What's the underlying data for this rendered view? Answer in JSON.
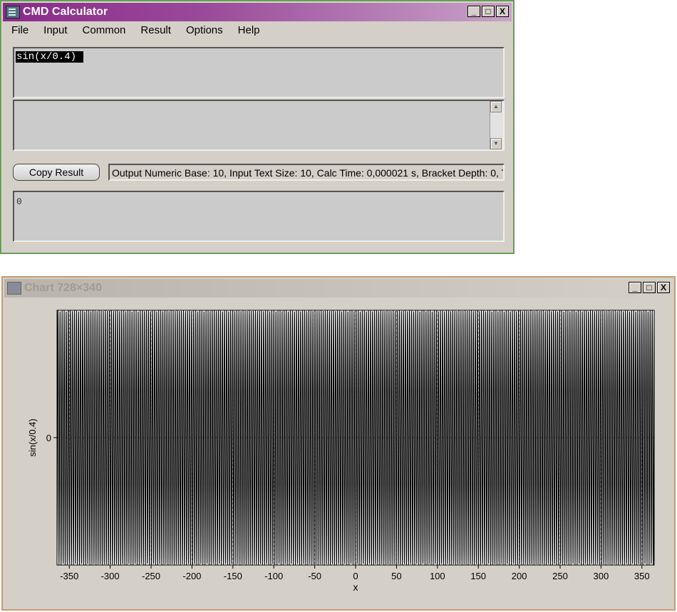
{
  "calculator": {
    "title": "CMD Calculator",
    "menu": [
      "File",
      "Input",
      "Common",
      "Result",
      "Options",
      "Help"
    ],
    "expression": "sin(x/0.4)",
    "copy_button_label": "Copy Result",
    "status_text": "Output Numeric Base: 10, Input Text Size: 10, Calc Time: 0,000021 s, Bracket Depth: 0, T",
    "result": "0",
    "window_buttons": {
      "minimize": "_",
      "maximize": "□",
      "close": "X"
    }
  },
  "chart_window": {
    "title": "Chart 728×340",
    "window_buttons": {
      "minimize": "_",
      "maximize": "□",
      "close": "X"
    }
  },
  "chart_data": {
    "type": "line",
    "title": "",
    "xlabel": "x",
    "ylabel": "sin(x/0.4)",
    "function": "sin(x/0.4)",
    "xlim": [
      -365,
      365
    ],
    "ylim": [
      -1,
      1
    ],
    "x_ticks": [
      -350,
      -300,
      -250,
      -200,
      -150,
      -100,
      -50,
      0,
      50,
      100,
      150,
      200,
      250,
      300,
      350
    ],
    "y_ticks": [
      0
    ],
    "grid": true,
    "line_color": "#000000",
    "background": "#ffffff"
  }
}
